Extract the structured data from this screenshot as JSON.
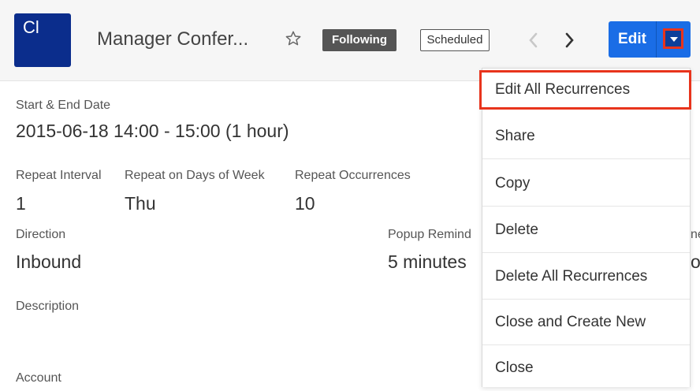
{
  "header": {
    "avatar_initials": "Cl",
    "title": "Manager Confer...",
    "following_label": "Following",
    "status_label": "Scheduled",
    "edit_label": "Edit",
    "colors": {
      "edit_button": "#1a6de6",
      "avatar_bg": "#0b2d8c",
      "highlight": "#e8341c"
    },
    "icons": [
      "star-icon",
      "chevron-left-icon",
      "chevron-right-icon",
      "caret-down-icon"
    ]
  },
  "fields": {
    "start_end_label": "Start & End Date",
    "start_end_value": "2015-06-18 14:00 - 15:00 (1 hour)",
    "repeat_interval_label": "Repeat Interval",
    "repeat_interval_value": "1",
    "repeat_days_label": "Repeat on Days of Week",
    "repeat_days_value": "Thu",
    "repeat_occurrences_label": "Repeat Occurrences",
    "repeat_occurrences_value": "10",
    "direction_label": "Direction",
    "direction_value": "Inbound",
    "popup_reminder_label": "Popup Remind",
    "popup_reminder_value": "5 minutes",
    "description_label": "Description",
    "account_label": "Account",
    "partial_right_label": "ne",
    "partial_right_value": "o"
  },
  "menu": {
    "items": [
      "Edit All Recurrences",
      "Share",
      "Copy",
      "Delete",
      "Delete All Recurrences",
      "Close and Create New",
      "Close"
    ]
  }
}
